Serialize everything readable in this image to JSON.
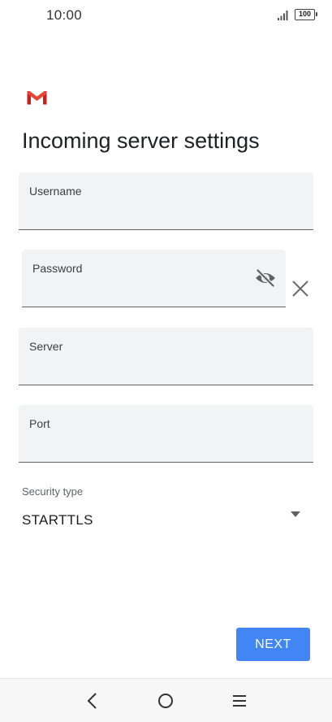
{
  "status_bar": {
    "time": "10:00",
    "battery": "100"
  },
  "icons": {
    "app": "gmail-logo",
    "signal": "signal-icon",
    "visibility": "eye-off-icon",
    "clear": "close-icon",
    "dropdown": "caret-down-icon",
    "nav_back": "back-icon",
    "nav_home": "home-icon",
    "nav_menu": "menu-icon"
  },
  "page": {
    "title": "Incoming server settings"
  },
  "form": {
    "username": {
      "label": "Username",
      "value": ""
    },
    "password": {
      "label": "Password",
      "value": ""
    },
    "server": {
      "label": "Server",
      "value": ""
    },
    "port": {
      "label": "Port",
      "value": ""
    },
    "security": {
      "label": "Security type",
      "value": "STARTTLS"
    }
  },
  "actions": {
    "next_label": "NEXT"
  },
  "colors": {
    "accent": "#4285f4",
    "field_bg": "#f1f3f4",
    "gmail_red": "#ea4335"
  }
}
